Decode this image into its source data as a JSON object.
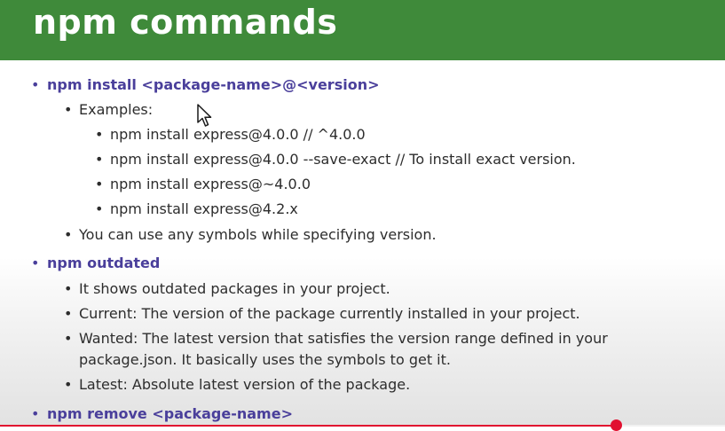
{
  "slide": {
    "title": "npm commands",
    "items": [
      {
        "level": 1,
        "text": "npm install <package-name>@<version>"
      },
      {
        "level": 2,
        "text": "Examples:"
      },
      {
        "level": 3,
        "text": "npm install express@4.0.0 // ^4.0.0"
      },
      {
        "level": 3,
        "text": "npm install express@4.0.0 --save-exact // To install exact version."
      },
      {
        "level": 3,
        "text": "npm install express@~4.0.0"
      },
      {
        "level": 3,
        "text": "npm install express@4.2.x"
      },
      {
        "level": 2,
        "text": "You can use any symbols while specifying version."
      },
      {
        "level": 1,
        "text": "npm outdated"
      },
      {
        "level": 2,
        "text": "It shows outdated packages in your project."
      },
      {
        "level": 2,
        "text": "Current: The version of the package currently installed in your project."
      },
      {
        "level": 2,
        "text": "Wanted: The latest version that satisfies the version range defined in your"
      },
      {
        "level": 2,
        "text": "package.json. It basically uses the symbols to get it.",
        "continuation": true
      },
      {
        "level": 2,
        "text": "Latest: Absolute latest version of the package."
      },
      {
        "level": 1,
        "text": "npm remove <package-name>"
      }
    ]
  },
  "colors": {
    "header_bg": "#3f8a3a",
    "accent_purple": "#4a3f9b",
    "body_text": "#2d2d2d",
    "progress": "#e11030"
  },
  "icons": {
    "bullet": "•",
    "cursor": "mouse-pointer-icon"
  },
  "video": {
    "progress_fraction": 0.849
  }
}
